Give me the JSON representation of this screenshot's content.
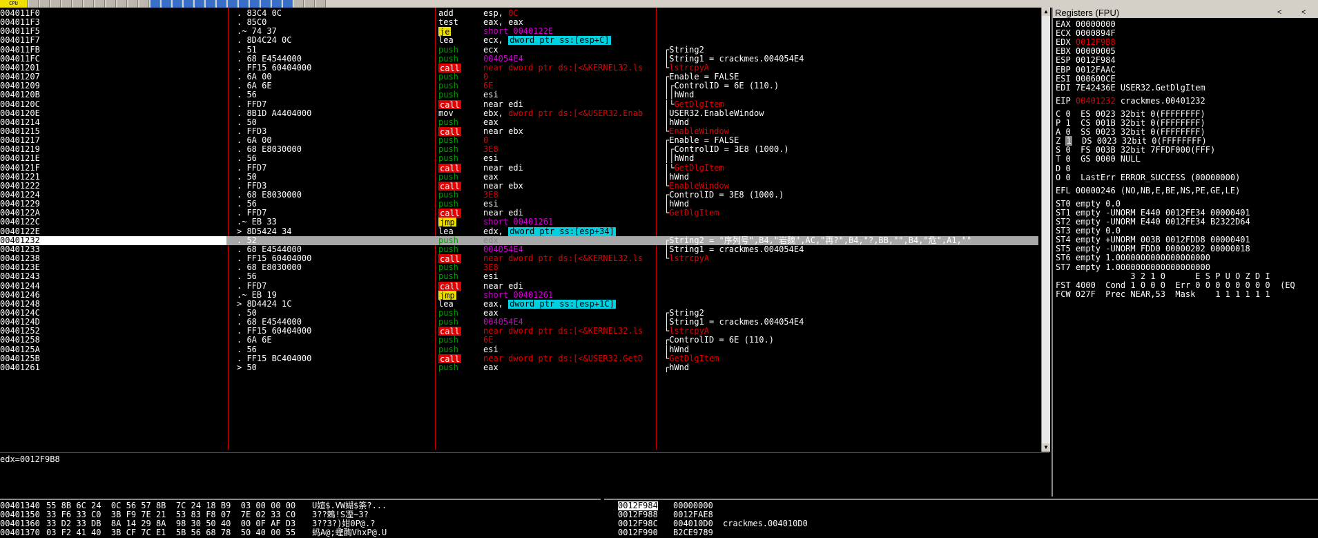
{
  "toolbar": {
    "title_snippet": "CPU"
  },
  "disasm": {
    "rows": [
      {
        "addr": "004011F0",
        "hex": ".  83C4 0C",
        "mn": "add",
        "mt": "plain",
        "ops": [
          {
            "t": "esp, ",
            "c": ""
          },
          {
            "t": "0C",
            "c": "r"
          }
        ],
        "cm": []
      },
      {
        "addr": "004011F3",
        "hex": ".  85C0",
        "mn": "test",
        "mt": "plain",
        "ops": [
          {
            "t": "eax, eax",
            "c": ""
          }
        ],
        "cm": []
      },
      {
        "addr": "004011F5",
        "hex": ".~ 74 37",
        "mn": "je",
        "mt": "jmp",
        "ops": [
          {
            "t": "short 0040122E",
            "c": "c"
          }
        ],
        "cm": []
      },
      {
        "addr": "004011F7",
        "hex": ".  8D4C24 0C",
        "mn": "lea",
        "mt": "plain",
        "ops": [
          {
            "t": "ecx, ",
            "c": ""
          },
          {
            "t": "dword ptr ss:[esp+C]",
            "c": "m"
          }
        ],
        "cm": []
      },
      {
        "addr": "004011FB",
        "hex": ".  51",
        "mn": "push",
        "mt": "push",
        "ops": [
          {
            "t": "ecx",
            "c": ""
          }
        ],
        "cm": [
          {
            "t": "┌String2",
            "c": ""
          }
        ]
      },
      {
        "addr": "004011FC",
        "hex": ".  68 E4544000",
        "mn": "push",
        "mt": "push",
        "ops": [
          {
            "t": "004054E4",
            "c": "c"
          }
        ],
        "cm": [
          {
            "t": "│String1 = crackmes.004054E4",
            "c": ""
          }
        ]
      },
      {
        "addr": "00401201",
        "hex": ".  FF15 60404000",
        "mn": "call",
        "mt": "call",
        "ops": [
          {
            "t": "near dword ptr ds:[<&KERNEL32.ls",
            "c": "r"
          }
        ],
        "cm": [
          {
            "t": "└",
            "c": ""
          },
          {
            "t": "lstrcpyA",
            "c": "r"
          }
        ]
      },
      {
        "addr": "00401207",
        "hex": ".  6A 00",
        "mn": "push",
        "mt": "push",
        "ops": [
          {
            "t": "0",
            "c": "r"
          }
        ],
        "cm": [
          {
            "t": "┌Enable = FALSE",
            "c": ""
          }
        ]
      },
      {
        "addr": "00401209",
        "hex": ".  6A 6E",
        "mn": "push",
        "mt": "push",
        "ops": [
          {
            "t": "6E",
            "c": "r"
          }
        ],
        "cm": [
          {
            "t": "│┌ControlID = 6E (110.)",
            "c": ""
          }
        ]
      },
      {
        "addr": "0040120B",
        "hex": ".  56",
        "mn": "push",
        "mt": "push",
        "ops": [
          {
            "t": "esi",
            "c": ""
          }
        ],
        "cm": [
          {
            "t": "││hWnd",
            "c": ""
          }
        ]
      },
      {
        "addr": "0040120C",
        "hex": ".  FFD7",
        "mn": "call",
        "mt": "call",
        "ops": [
          {
            "t": "near edi",
            "c": ""
          }
        ],
        "cm": [
          {
            "t": "│└",
            "c": ""
          },
          {
            "t": "GetDlgItem",
            "c": "r"
          }
        ]
      },
      {
        "addr": "0040120E",
        "hex": ".  8B1D A4404000",
        "mn": "mov",
        "mt": "plain",
        "ops": [
          {
            "t": "ebx, ",
            "c": ""
          },
          {
            "t": "dword ptr ds:[<&USER32.Enab",
            "c": "r"
          }
        ],
        "cm": [
          {
            "t": "│USER32.EnableWindow",
            "c": ""
          }
        ]
      },
      {
        "addr": "00401214",
        "hex": ".  50",
        "mn": "push",
        "mt": "push",
        "ops": [
          {
            "t": "eax",
            "c": ""
          }
        ],
        "cm": [
          {
            "t": "│hWnd",
            "c": ""
          }
        ]
      },
      {
        "addr": "00401215",
        "hex": ".  FFD3",
        "mn": "call",
        "mt": "call",
        "ops": [
          {
            "t": "near ebx",
            "c": ""
          }
        ],
        "cm": [
          {
            "t": "└",
            "c": ""
          },
          {
            "t": "EnableWindow",
            "c": "r"
          }
        ]
      },
      {
        "addr": "00401217",
        "hex": ".  6A 00",
        "mn": "push",
        "mt": "push",
        "ops": [
          {
            "t": "0",
            "c": "r"
          }
        ],
        "cm": [
          {
            "t": "┌Enable = FALSE",
            "c": ""
          }
        ]
      },
      {
        "addr": "00401219",
        "hex": ".  68 E8030000",
        "mn": "push",
        "mt": "push",
        "ops": [
          {
            "t": "3E8",
            "c": "r"
          }
        ],
        "cm": [
          {
            "t": "│┌ControlID = 3E8 (1000.)",
            "c": ""
          }
        ]
      },
      {
        "addr": "0040121E",
        "hex": ".  56",
        "mn": "push",
        "mt": "push",
        "ops": [
          {
            "t": "esi",
            "c": ""
          }
        ],
        "cm": [
          {
            "t": "││hWnd",
            "c": ""
          }
        ]
      },
      {
        "addr": "0040121F",
        "hex": ".  FFD7",
        "mn": "call",
        "mt": "call",
        "ops": [
          {
            "t": "near edi",
            "c": ""
          }
        ],
        "cm": [
          {
            "t": "│└",
            "c": ""
          },
          {
            "t": "GetDlgItem",
            "c": "r"
          }
        ]
      },
      {
        "addr": "00401221",
        "hex": ".  50",
        "mn": "push",
        "mt": "push",
        "ops": [
          {
            "t": "eax",
            "c": ""
          }
        ],
        "cm": [
          {
            "t": "│hWnd",
            "c": ""
          }
        ]
      },
      {
        "addr": "00401222",
        "hex": ".  FFD3",
        "mn": "call",
        "mt": "call",
        "ops": [
          {
            "t": "near ebx",
            "c": ""
          }
        ],
        "cm": [
          {
            "t": "└",
            "c": ""
          },
          {
            "t": "EnableWindow",
            "c": "r"
          }
        ]
      },
      {
        "addr": "00401224",
        "hex": ".  68 E8030000",
        "mn": "push",
        "mt": "push",
        "ops": [
          {
            "t": "3E8",
            "c": "r"
          }
        ],
        "cm": [
          {
            "t": "┌ControlID = 3E8 (1000.)",
            "c": ""
          }
        ]
      },
      {
        "addr": "00401229",
        "hex": ".  56",
        "mn": "push",
        "mt": "push",
        "ops": [
          {
            "t": "esi",
            "c": ""
          }
        ],
        "cm": [
          {
            "t": "│hWnd",
            "c": ""
          }
        ]
      },
      {
        "addr": "0040122A",
        "hex": ".  FFD7",
        "mn": "call",
        "mt": "call",
        "ops": [
          {
            "t": "near edi",
            "c": ""
          }
        ],
        "cm": [
          {
            "t": "└",
            "c": ""
          },
          {
            "t": "GetDlgItem",
            "c": "r"
          }
        ]
      },
      {
        "addr": "0040122C",
        "hex": ".~ EB 33",
        "mn": "jmp",
        "mt": "jmp",
        "ops": [
          {
            "t": "short 00401261",
            "c": "c"
          }
        ],
        "cm": []
      },
      {
        "addr": "0040122E",
        "hex": ">  8D5424 34",
        "mn": "lea",
        "mt": "plain",
        "ops": [
          {
            "t": "edx, ",
            "c": ""
          },
          {
            "t": "dword ptr ss:[esp+34]",
            "c": "m"
          }
        ],
        "cm": []
      },
      {
        "addr": "00401232",
        "hex": ".  52",
        "mn": "push",
        "mt": "push",
        "ops": [
          {
            "t": "edx",
            "c": "g"
          }
        ],
        "cm": [
          {
            "t": "┌String2 = \"序列号\",B4,\"岩魏\",AC,\"再?\",B4,\"?,BB,\"\",B4,\"危\",A1,\"\"",
            "c": ""
          }
        ],
        "sel": true
      },
      {
        "addr": "00401233",
        "hex": ".  68 E4544000",
        "mn": "push",
        "mt": "push",
        "ops": [
          {
            "t": "004054E4",
            "c": "c"
          }
        ],
        "cm": [
          {
            "t": "│String1 = crackmes.004054E4",
            "c": ""
          }
        ]
      },
      {
        "addr": "00401238",
        "hex": ".  FF15 60404000",
        "mn": "call",
        "mt": "call",
        "ops": [
          {
            "t": "near dword ptr ds:[<&KERNEL32.ls",
            "c": "r"
          }
        ],
        "cm": [
          {
            "t": "└",
            "c": ""
          },
          {
            "t": "lstrcpyA",
            "c": "r"
          }
        ]
      },
      {
        "addr": "0040123E",
        "hex": ".  68 E8030000",
        "mn": "push",
        "mt": "push",
        "ops": [
          {
            "t": "3E8",
            "c": "r"
          }
        ],
        "cm": []
      },
      {
        "addr": "00401243",
        "hex": ".  56",
        "mn": "push",
        "mt": "push",
        "ops": [
          {
            "t": "esi",
            "c": ""
          }
        ],
        "cm": []
      },
      {
        "addr": "00401244",
        "hex": ".  FFD7",
        "mn": "call",
        "mt": "call",
        "ops": [
          {
            "t": "near edi",
            "c": ""
          }
        ],
        "cm": []
      },
      {
        "addr": "00401246",
        "hex": ".~ EB 19",
        "mn": "jmp",
        "mt": "jmp",
        "ops": [
          {
            "t": "short 00401261",
            "c": "c"
          }
        ],
        "cm": []
      },
      {
        "addr": "00401248",
        "hex": ">  8D4424 1C",
        "mn": "lea",
        "mt": "plain",
        "ops": [
          {
            "t": "eax, ",
            "c": ""
          },
          {
            "t": "dword ptr ss:[esp+1C]",
            "c": "m"
          }
        ],
        "cm": []
      },
      {
        "addr": "0040124C",
        "hex": ".  50",
        "mn": "push",
        "mt": "push",
        "ops": [
          {
            "t": "eax",
            "c": ""
          }
        ],
        "cm": [
          {
            "t": "┌String2",
            "c": ""
          }
        ]
      },
      {
        "addr": "0040124D",
        "hex": ".  68 E4544000",
        "mn": "push",
        "mt": "push",
        "ops": [
          {
            "t": "004054E4",
            "c": "c"
          }
        ],
        "cm": [
          {
            "t": "│String1 = crackmes.004054E4",
            "c": ""
          }
        ]
      },
      {
        "addr": "00401252",
        "hex": ".  FF15 60404000",
        "mn": "call",
        "mt": "call",
        "ops": [
          {
            "t": "near dword ptr ds:[<&KERNEL32.ls",
            "c": "r"
          }
        ],
        "cm": [
          {
            "t": "└",
            "c": ""
          },
          {
            "t": "lstrcpyA",
            "c": "r"
          }
        ]
      },
      {
        "addr": "00401258",
        "hex": ".  6A 6E",
        "mn": "push",
        "mt": "push",
        "ops": [
          {
            "t": "6E",
            "c": "r"
          }
        ],
        "cm": [
          {
            "t": "┌ControlID = 6E (110.)",
            "c": ""
          }
        ]
      },
      {
        "addr": "0040125A",
        "hex": ".  56",
        "mn": "push",
        "mt": "push",
        "ops": [
          {
            "t": "esi",
            "c": ""
          }
        ],
        "cm": [
          {
            "t": "│hWnd",
            "c": ""
          }
        ]
      },
      {
        "addr": "0040125B",
        "hex": ".  FF15 BC404000",
        "mn": "call",
        "mt": "call",
        "ops": [
          {
            "t": "near dword ptr ds:[<&USER32.GetD",
            "c": "r"
          }
        ],
        "cm": [
          {
            "t": "└",
            "c": ""
          },
          {
            "t": "GetDlgItem",
            "c": "r"
          }
        ]
      },
      {
        "addr": "00401261",
        "hex": ">  50",
        "mn": "push",
        "mt": "push",
        "ops": [
          {
            "t": "eax",
            "c": ""
          }
        ],
        "cm": [
          {
            "t": "┌hWnd",
            "c": ""
          }
        ]
      }
    ]
  },
  "info": {
    "text": "edx=0012F9B8"
  },
  "registers": {
    "title": "Registers (FPU)",
    "nav_left": "<",
    "nav_right": "<",
    "lines": [
      {
        "parts": [
          {
            "t": "EAX 00000000",
            "c": ""
          }
        ]
      },
      {
        "parts": [
          {
            "t": "ECX 0000894F",
            "c": ""
          }
        ]
      },
      {
        "parts": [
          {
            "t": "EDX ",
            "c": ""
          },
          {
            "t": "0012F9B8",
            "c": "r"
          }
        ]
      },
      {
        "parts": [
          {
            "t": "EBX 00000005",
            "c": ""
          }
        ]
      },
      {
        "parts": [
          {
            "t": "ESP 0012F984",
            "c": ""
          }
        ]
      },
      {
        "parts": [
          {
            "t": "EBP 0012FAAC",
            "c": ""
          }
        ]
      },
      {
        "parts": [
          {
            "t": "ESI 000600CE",
            "c": ""
          }
        ]
      },
      {
        "parts": [
          {
            "t": "EDI 7E42436E USER32.GetDlgItem",
            "c": ""
          }
        ]
      },
      {
        "gap": true,
        "parts": [
          {
            "t": "EIP ",
            "c": ""
          },
          {
            "t": "00401232",
            "c": "r"
          },
          {
            "t": " crackmes.00401232",
            "c": ""
          }
        ]
      },
      {
        "gap": true,
        "parts": [
          {
            "t": "C 0  ES 0023 32bit 0(FFFFFFFF)",
            "c": ""
          }
        ]
      },
      {
        "parts": [
          {
            "t": "P 1  CS 001B 32bit 0(FFFFFFFF)",
            "c": ""
          }
        ]
      },
      {
        "parts": [
          {
            "t": "A 0  SS 0023 32bit 0(FFFFFFFF)",
            "c": ""
          }
        ]
      },
      {
        "parts": [
          {
            "t": "Z ",
            "c": ""
          },
          {
            "t": "1",
            "c": "box"
          },
          {
            "t": "  DS 0023 32bit 0(FFFFFFFF)",
            "c": ""
          }
        ]
      },
      {
        "parts": [
          {
            "t": "S 0  FS 003B 32bit 7FFDF000(FFF)",
            "c": ""
          }
        ]
      },
      {
        "parts": [
          {
            "t": "T 0  GS 0000 NULL",
            "c": ""
          }
        ]
      },
      {
        "parts": [
          {
            "t": "D 0",
            "c": ""
          }
        ]
      },
      {
        "parts": [
          {
            "t": "O 0  LastErr ERROR_SUCCESS (00000000)",
            "c": ""
          }
        ]
      },
      {
        "gap": true,
        "parts": [
          {
            "t": "EFL 00000246 (NO,NB,E,BE,NS,PE,GE,LE)",
            "c": ""
          }
        ]
      },
      {
        "gap": true,
        "parts": [
          {
            "t": "ST0 empty 0.0",
            "c": ""
          }
        ]
      },
      {
        "parts": [
          {
            "t": "ST1 empty -UNORM E440 0012FE34 00000401",
            "c": ""
          }
        ]
      },
      {
        "parts": [
          {
            "t": "ST2 empty -UNORM E440 0012FE34 B2322D64",
            "c": ""
          }
        ]
      },
      {
        "parts": [
          {
            "t": "ST3 empty 0.0",
            "c": ""
          }
        ]
      },
      {
        "parts": [
          {
            "t": "ST4 empty +UNORM 003B 0012FDD8 00000401",
            "c": ""
          }
        ]
      },
      {
        "parts": [
          {
            "t": "ST5 empty -UNORM FDD0 00000202 00000018",
            "c": ""
          }
        ]
      },
      {
        "parts": [
          {
            "t": "ST6 empty 1.0000000000000000000",
            "c": ""
          }
        ]
      },
      {
        "parts": [
          {
            "t": "ST7 empty 1.0000000000000000000",
            "c": ""
          }
        ]
      },
      {
        "parts": [
          {
            "t": "               3 2 1 0      E S P U O Z D I",
            "c": ""
          }
        ]
      },
      {
        "parts": [
          {
            "t": "FST 4000  Cond 1 0 0 0  Err 0 0 0 0 0 0 0 0  (EQ",
            "c": ""
          }
        ]
      },
      {
        "parts": [
          {
            "t": "FCW 027F  Prec NEAR,53  Mask    1 1 1 1 1 1",
            "c": ""
          }
        ]
      }
    ]
  },
  "dump": {
    "rows": [
      {
        "addr": "00401340",
        "hex": "55 8B 6C 24  0C 56 57 8B  7C 24 18 B9  03 00 00 00",
        "asc": "U媗$.VW媩$筡?..."
      },
      {
        "addr": "00401350",
        "hex": "33 F6 33 C0  3B F9 7E 21  53 83 F8 07  7E 02 33 C0",
        "asc": "3??鵣!S凐~3?"
      },
      {
        "addr": "00401360",
        "hex": "33 D2 33 DB  8A 14 29 8A  98 30 50 40  00 0F AF D3",
        "asc": "3??3?)姏0P@.?"
      },
      {
        "addr": "00401370",
        "hex": "03 F2 41 40  3B CF 7C E1  5B 56 68 78  50 40 00 55",
        "asc": "蚂A@;蟶醄VhxP@.U"
      }
    ]
  },
  "stack": {
    "rows": [
      {
        "addr": "0012F984",
        "val": "00000000",
        "cm": "",
        "sel": true
      },
      {
        "addr": "0012F988",
        "val": "0012FAE8",
        "cm": ""
      },
      {
        "addr": "0012F98C",
        "val": "004010D0",
        "cm": "crackmes.004010D0"
      },
      {
        "addr": "0012F990",
        "val": "B2CE9789",
        "cm": ""
      }
    ]
  }
}
